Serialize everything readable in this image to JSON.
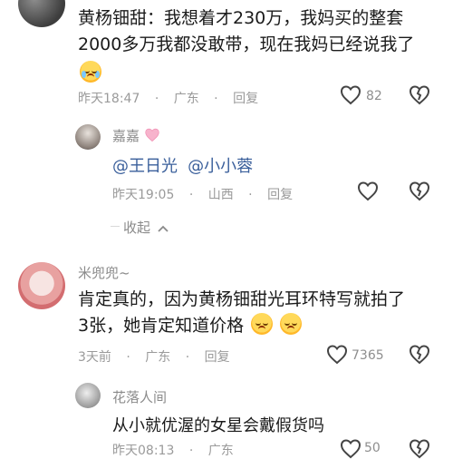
{
  "comment1": {
    "text_line1": "黄杨钿甜：我想着才230万，我妈买的整套",
    "text_line2": "2000多万我都没敢带，现在我妈已经说我了",
    "time": "昨天18:47",
    "location": "广东",
    "reply": "回复",
    "likes": "82"
  },
  "reply1": {
    "name": "嘉嘉",
    "mention1": "@王日光",
    "mention2": "@小小蓉",
    "time": "昨天19:05",
    "location": "山西",
    "reply": "回复"
  },
  "collapse": {
    "label": "收起"
  },
  "comment2": {
    "name": "米兜兜~",
    "text_line1": "肯定真的，因为黄杨钿甜光耳环特写就拍了",
    "text_line2": "3张，她肯定知道价格",
    "time": "3天前",
    "location": "广东",
    "reply": "回复",
    "likes": "7365"
  },
  "reply2": {
    "name": "花落人间",
    "text": "从小就优渥的女星会戴假货吗",
    "time": "昨天08:13",
    "location": "广东",
    "likes": "50"
  },
  "icons": {
    "like": "heart-outline-icon",
    "dislike": "broken-heart-icon",
    "pink_heart": "pink-heart-icon"
  },
  "colors": {
    "mention": "#3a5f9b",
    "meta": "#9a9a9a"
  }
}
